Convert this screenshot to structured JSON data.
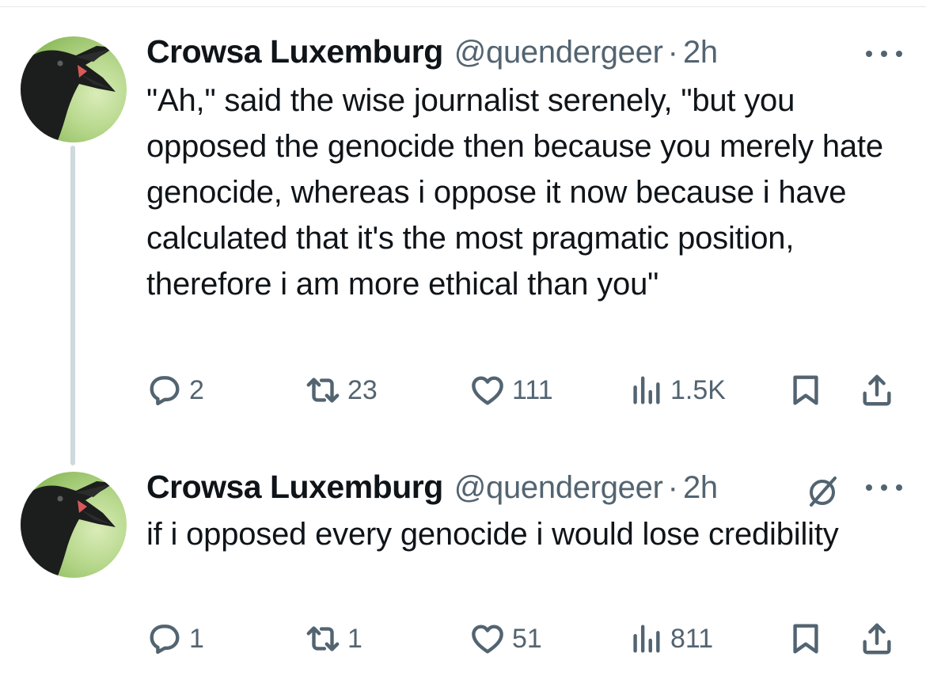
{
  "tweets": [
    {
      "display_name": "Crowsa Luxemburg",
      "handle": "@quendergeer",
      "separator": "·",
      "time": "2h",
      "text": "\"Ah,\" said the wise journalist serenely, \"but you opposed the genocide then because you merely hate genocide, whereas i oppose it now because i have calculated that it's the most pragmatic position, therefore i am more ethical than you\"",
      "replies": "2",
      "retweets": "23",
      "likes": "111",
      "views": "1.5K"
    },
    {
      "display_name": "Crowsa Luxemburg",
      "handle": "@quendergeer",
      "separator": "·",
      "time": "2h",
      "text": "if i opposed every genocide i would lose credibility",
      "replies": "1",
      "retweets": "1",
      "likes": "51",
      "views": "811"
    }
  ],
  "icons": {
    "avatar": "crow-avatar",
    "reply": "reply-icon",
    "retweet": "retweet-icon",
    "like": "heart-icon",
    "views": "views-icon",
    "bookmark": "bookmark-icon",
    "share": "share-icon",
    "more": "more-icon",
    "grok": "grok-icon"
  },
  "colors": {
    "text": "#0f1419",
    "secondary": "#536471",
    "thread_line": "#cfd9de"
  }
}
